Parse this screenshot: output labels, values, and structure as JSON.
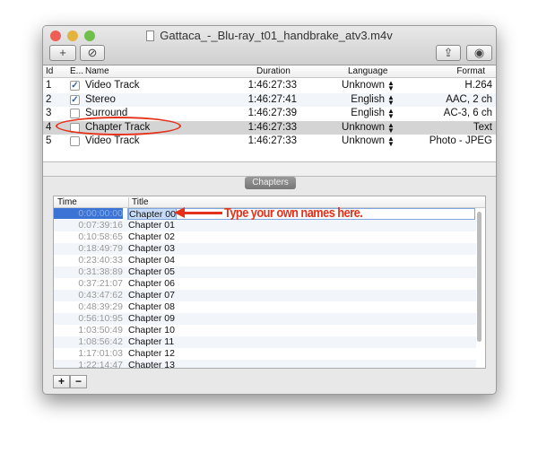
{
  "window": {
    "title": "Gattaca_-_Blu-ray_t01_handbrake_atv3.m4v"
  },
  "toolbar": {
    "add": "+",
    "disable": "⊘",
    "share": "⇪",
    "inspect": "◉"
  },
  "tracks": {
    "headers": [
      "Id",
      "E...",
      "Name",
      "Duration",
      "Language",
      "Format"
    ],
    "rows": [
      {
        "id": "1",
        "enabled": true,
        "name": "Video Track",
        "duration": "1:46:27:33",
        "language": "Unknown",
        "format": "H.264"
      },
      {
        "id": "2",
        "enabled": true,
        "name": "Stereo",
        "duration": "1:46:27:41",
        "language": "English",
        "format": "AAC, 2 ch"
      },
      {
        "id": "3",
        "enabled": false,
        "name": "Surround",
        "duration": "1:46:27:39",
        "language": "English",
        "format": "AC-3, 6 ch"
      },
      {
        "id": "4",
        "enabled": false,
        "name": "Chapter Track",
        "duration": "1:46:27:33",
        "language": "Unknown",
        "format": "Text"
      },
      {
        "id": "5",
        "enabled": false,
        "name": "Video Track",
        "duration": "1:46:27:33",
        "language": "Unknown",
        "format": "Photo - JPEG"
      }
    ]
  },
  "chapters": {
    "tab": "Chapters",
    "headers": [
      "Time",
      "Title"
    ],
    "rows": [
      {
        "time": "0:00:00:00",
        "title": "Chapter 00"
      },
      {
        "time": "0:07:39:16",
        "title": "Chapter 01"
      },
      {
        "time": "0:10:58:65",
        "title": "Chapter 02"
      },
      {
        "time": "0:18:49:79",
        "title": "Chapter 03"
      },
      {
        "time": "0:23:40:33",
        "title": "Chapter 04"
      },
      {
        "time": "0:31:38:89",
        "title": "Chapter 05"
      },
      {
        "time": "0:37:21:07",
        "title": "Chapter 06"
      },
      {
        "time": "0:43:47:62",
        "title": "Chapter 07"
      },
      {
        "time": "0:48:39:29",
        "title": "Chapter 08"
      },
      {
        "time": "0:56:10:95",
        "title": "Chapter 09"
      },
      {
        "time": "1:03:50:49",
        "title": "Chapter 10"
      },
      {
        "time": "1:08:56:42",
        "title": "Chapter 11"
      },
      {
        "time": "1:17:01:03",
        "title": "Chapter 12"
      },
      {
        "time": "1:22:14:47",
        "title": "Chapter 13"
      }
    ],
    "add": "+",
    "remove": "−"
  },
  "annotation": {
    "text": "Type your own names here.",
    "color": "#e5301a"
  }
}
